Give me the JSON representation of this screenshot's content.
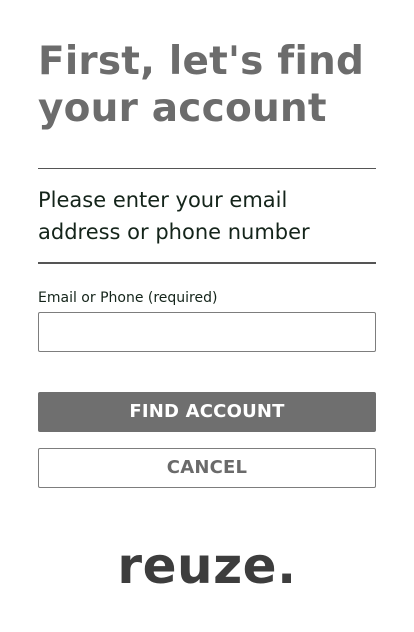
{
  "header": {
    "title": "First, let's find your account"
  },
  "instructions": {
    "text": "Please enter your email address or phone number"
  },
  "form": {
    "email_phone_label": "Email or Phone (required)",
    "email_phone_value": "",
    "email_phone_placeholder": ""
  },
  "actions": {
    "find_account_label": "FIND ACCOUNT",
    "cancel_label": "CANCEL"
  },
  "brand": {
    "logo_text": "reuze."
  },
  "colors": {
    "title": "#6c6c6c",
    "body_text": "#14241a",
    "primary_button_bg": "#6f6f6f",
    "primary_button_text": "#ffffff",
    "secondary_button_text": "#6a6a6a",
    "logo": "#3d3d3d"
  }
}
